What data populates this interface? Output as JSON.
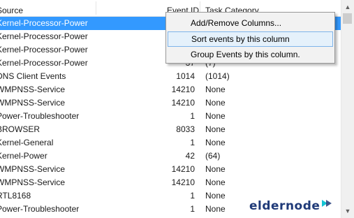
{
  "columns": {
    "source": "Source",
    "event_id": "Event ID",
    "task_category": "Task Category"
  },
  "rows": [
    {
      "source": "Kernel-Processor-Power",
      "event_id": "",
      "category": ""
    },
    {
      "source": "Kernel-Processor-Power",
      "event_id": "",
      "category": ""
    },
    {
      "source": "Kernel-Processor-Power",
      "event_id": "",
      "category": ""
    },
    {
      "source": "Kernel-Processor-Power",
      "event_id": "37",
      "category": "(7)"
    },
    {
      "source": "DNS Client Events",
      "event_id": "1014",
      "category": "(1014)"
    },
    {
      "source": "WMPNSS-Service",
      "event_id": "14210",
      "category": "None"
    },
    {
      "source": "WMPNSS-Service",
      "event_id": "14210",
      "category": "None"
    },
    {
      "source": "Power-Troubleshooter",
      "event_id": "1",
      "category": "None"
    },
    {
      "source": "BROWSER",
      "event_id": "8033",
      "category": "None"
    },
    {
      "source": "Kernel-General",
      "event_id": "1",
      "category": "None"
    },
    {
      "source": "Kernel-Power",
      "event_id": "42",
      "category": "(64)"
    },
    {
      "source": "WMPNSS-Service",
      "event_id": "14210",
      "category": "None"
    },
    {
      "source": "WMPNSS-Service",
      "event_id": "14210",
      "category": "None"
    },
    {
      "source": "RTL8168",
      "event_id": "1",
      "category": "None"
    },
    {
      "source": "Power-Troubleshooter",
      "event_id": "1",
      "category": "None"
    }
  ],
  "context_menu": {
    "add_remove": "Add/Remove Columns...",
    "sort": "Sort events by this column",
    "group": "Group Events by this column."
  },
  "logo": {
    "text": "eldernode",
    "accent": "#14c4d4"
  },
  "colors": {
    "selection": "#3399ff",
    "menu_highlight": "#e5f1fb"
  }
}
